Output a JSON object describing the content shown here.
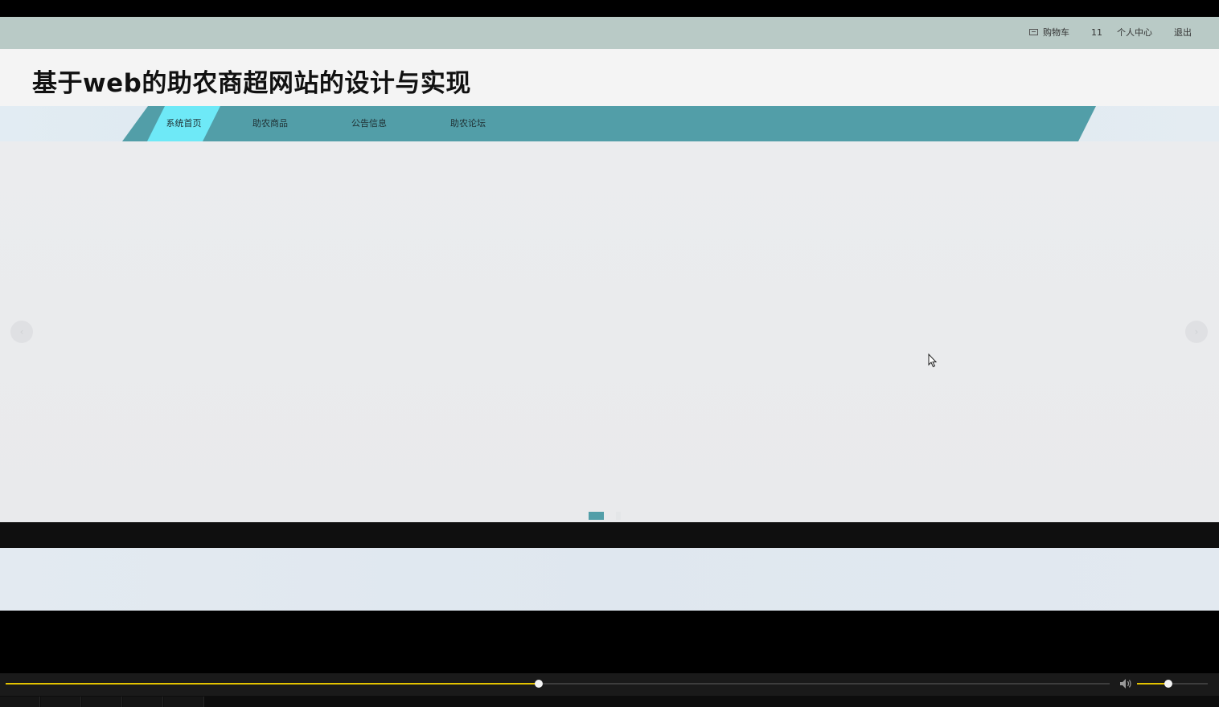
{
  "topbar": {
    "cart_label": "购物车",
    "username": "11",
    "profile_label": "个人中心",
    "logout_label": "退出"
  },
  "header": {
    "site_title": "基于web的助农商超网站的设计与实现"
  },
  "nav": {
    "items": [
      {
        "label": "系统首页",
        "active": true
      },
      {
        "label": "助农商品",
        "active": false
      },
      {
        "label": "公告信息",
        "active": false
      },
      {
        "label": "助农论坛",
        "active": false
      }
    ]
  },
  "carousel": {
    "prev_icon": "chevron-left-icon",
    "next_icon": "chevron-right-icon",
    "slide_count": 2,
    "active_slide": 1
  },
  "player": {
    "progress_fraction": 0.483,
    "volume_fraction": 0.44
  },
  "colors": {
    "topbar_bg": "#b9cac6",
    "nav_band": "#529ea8",
    "nav_active": "#6ee9f7",
    "progress": "#e3c200"
  }
}
